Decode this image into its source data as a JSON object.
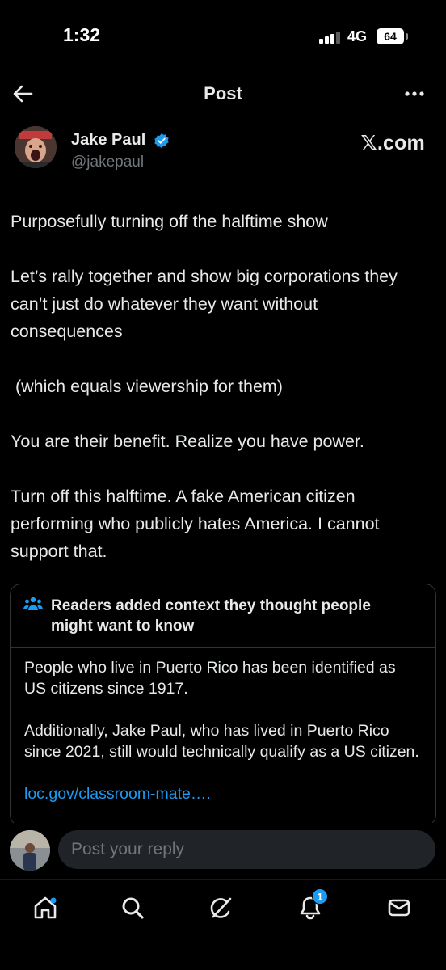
{
  "status_bar": {
    "time": "1:32",
    "network": "4G",
    "battery": "64"
  },
  "header": {
    "title": "Post",
    "back_icon": "back-arrow-icon",
    "more_icon": "more-dots-icon"
  },
  "author": {
    "name": "Jake Paul",
    "handle": "@jakepaul",
    "verified": true,
    "brand": "𝕏.com"
  },
  "post": {
    "paragraphs": [
      "Purposefully turning off the halftime show",
      "Let’s rally together and show big corporations they can’t just do whatever they want without consequences",
      " (which equals viewership for them)",
      "You are their benefit. Realize you have power.",
      "Turn off this halftime. A fake American citizen performing who publicly hates America. I cannot support that."
    ]
  },
  "community_note": {
    "title": "Readers added context they thought people might want to know",
    "paragraphs": [
      "People who live in Puerto Rico has been identified as US citizens since 1917.",
      "Additionally, Jake Paul, who has lived in Puerto Rico since 2021, still would technically qualify as a US citizen."
    ],
    "link": "loc.gov/classroom-mate…."
  },
  "reply": {
    "placeholder": "Post your reply"
  },
  "bottom_nav": {
    "items": [
      "home-icon",
      "search-icon",
      "grok-icon",
      "notifications-icon",
      "messages-icon"
    ],
    "notification_count": "1"
  },
  "colors": {
    "background": "#000000",
    "text": "#e7e9ea",
    "secondary_text": "#71767b",
    "accent": "#1d9bf0",
    "border": "#2f3336"
  }
}
